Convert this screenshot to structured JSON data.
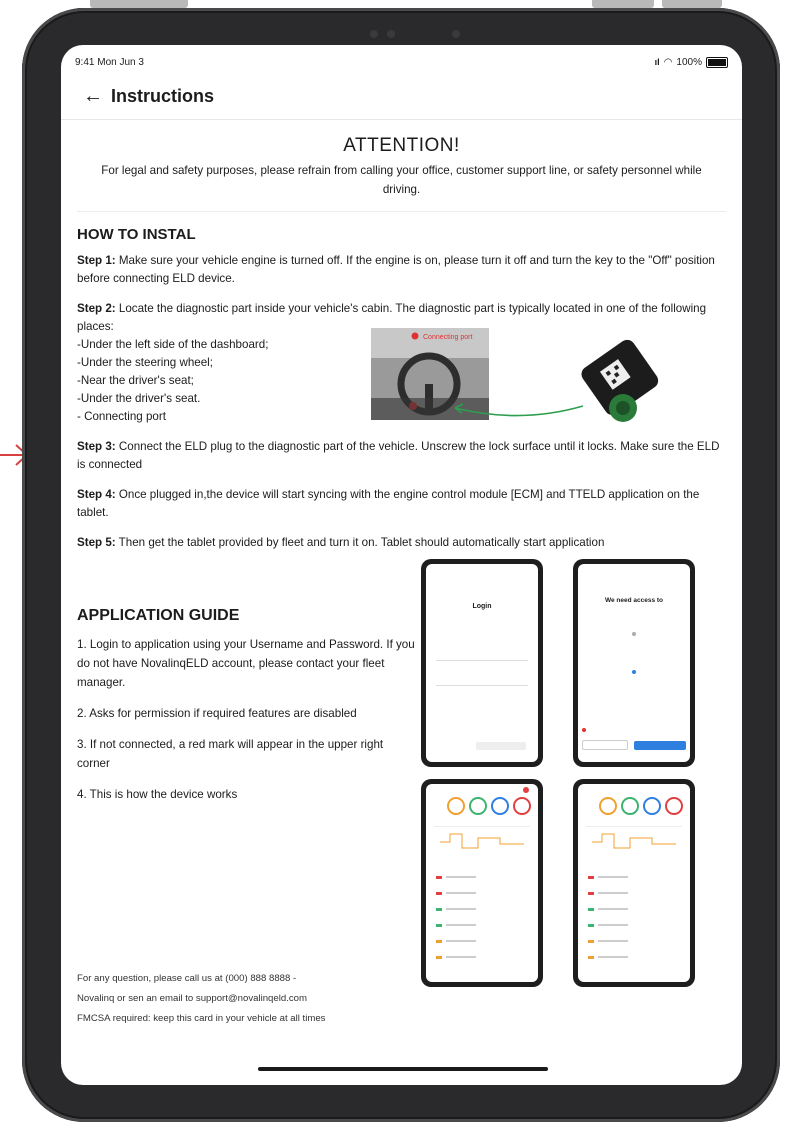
{
  "status_bar": {
    "time": "9:41 Mon Jun 3",
    "battery": "100%"
  },
  "header": {
    "title": "Instructions"
  },
  "attention": {
    "title": "ATTENTION!",
    "text": "For legal and safety purposes, please refrain from calling your office, customer support line, or safety personnel while driving."
  },
  "install": {
    "heading": "HOW TO INSTAL",
    "step1_label": "Step 1:",
    "step1_text": " Make sure your vehicle engine is turned off. If the engine is on, please turn it off and turn the key to the \"Off\" position before connecting ELD device.",
    "step2_label": "Step 2:",
    "step2_text": " Locate the diagnostic part inside your vehicle's cabin. The diagnostic part is typically located in one of the following places:",
    "locations": [
      "-Under the left side of the dashboard;",
      "-Under the steering wheel;",
      "-Near the driver's seat;",
      "-Under the driver's seat.",
      "- Connecting port"
    ],
    "connecting_port_label": "Connecting port",
    "step3_label": "Step 3:",
    "step3_text": " Connect the ELD plug to the diagnostic part of the vehicle. Unscrew the lock surface until it locks. Make sure the ELD is connected",
    "step4_label": "Step 4:",
    "step4_text": " Once plugged in,the device will start syncing with the engine control module [ECM] and TTELD application on the tablet.",
    "step5_label": "Step 5:",
    "step5_text": " Then get the tablet provided by fleet and turn it on. Tablet should automatically start application"
  },
  "guide": {
    "heading": "APPLICATION GUIDE",
    "items": [
      "1. Login to application using your Username and Password. If you do not have NovalinqELD account, please contact your fleet manager.",
      "2. Asks for permission if required features are disabled",
      "3. If not connected, a red mark will appear in the upper right corner",
      "4. This is how the device works"
    ],
    "login_title": "Login",
    "permission_title": "We need access to"
  },
  "footer": {
    "line1": "For any question, please call us at (000) 888 8888 -",
    "line2": "Novalinq or sen an email to support@novalinqeld.com",
    "line3": "FMCSA required: keep this card in your vehicle at all times"
  }
}
